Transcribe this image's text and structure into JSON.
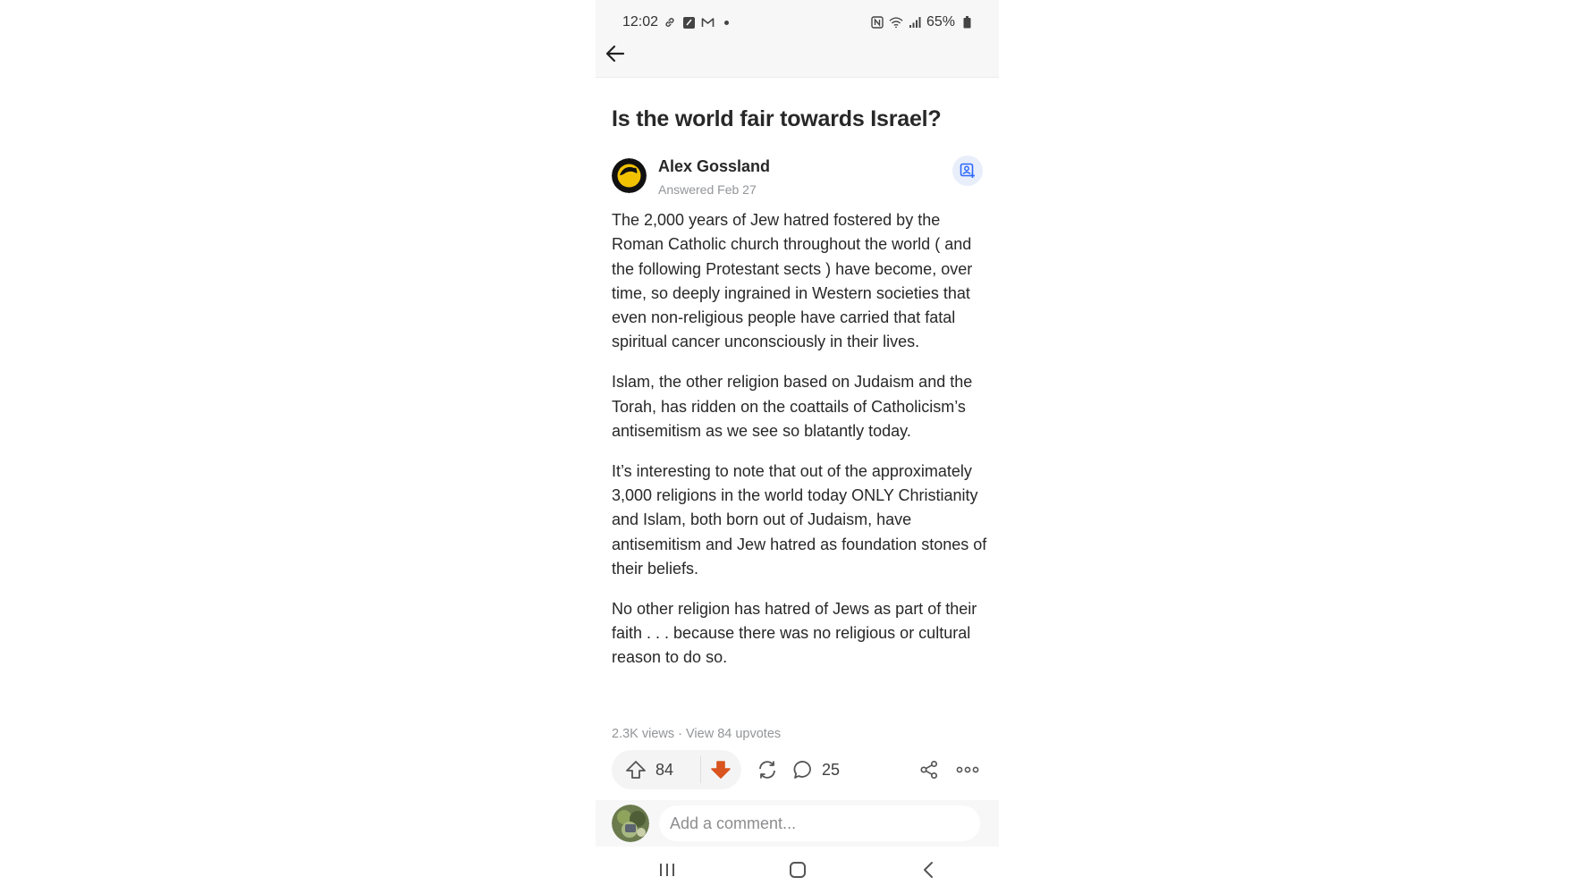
{
  "status_bar": {
    "time": "12:02",
    "left_icons": [
      "link-icon",
      "edit-square-icon",
      "gmail-icon",
      "dot-icon"
    ],
    "right_icons": [
      "nfc-icon",
      "wifi-icon",
      "signal-icon"
    ],
    "battery": "65%"
  },
  "app_bar": {
    "back_icon": "arrow-left-icon"
  },
  "question": {
    "title": "Is the world fair towards Israel?"
  },
  "answer": {
    "author_name": "Alex Gossland",
    "answered": "Answered Feb 27",
    "paragraphs": [
      "The 2,000 years of Jew hatred fostered by the Roman Catholic church throughout the world ( and the following Protestant sects ) have become, over time, so deeply ingrained in Western societies that even non-religious people have carried that fatal spiritual cancer unconsciously in their lives.",
      "Islam, the other religion based on Judaism and the Torah, has ridden on the coattails of Catholicism’s antisemitism as we see so blatantly today.",
      "It’s interesting to note that out of the approximately 3,000 religions in the world today ONLY Christianity and Islam, both born out of Judaism, have antisemitism and Jew hatred as foundation stones of their beliefs.",
      "No other religion has hatred of Jews as part of their faith . . . because there was no religious or cultural reason to do so."
    ],
    "views": "2.3K views",
    "meta_sep": " · ",
    "upvotes_link": "View 84 upvotes"
  },
  "actions": {
    "upvote_count": "84",
    "comment_count": "25"
  },
  "comment_box": {
    "placeholder": "Add a comment..."
  },
  "colors": {
    "downvote": "#d9541e",
    "follow_icon": "#2e69ff",
    "text_primary": "#282829",
    "text_secondary": "#939598"
  }
}
